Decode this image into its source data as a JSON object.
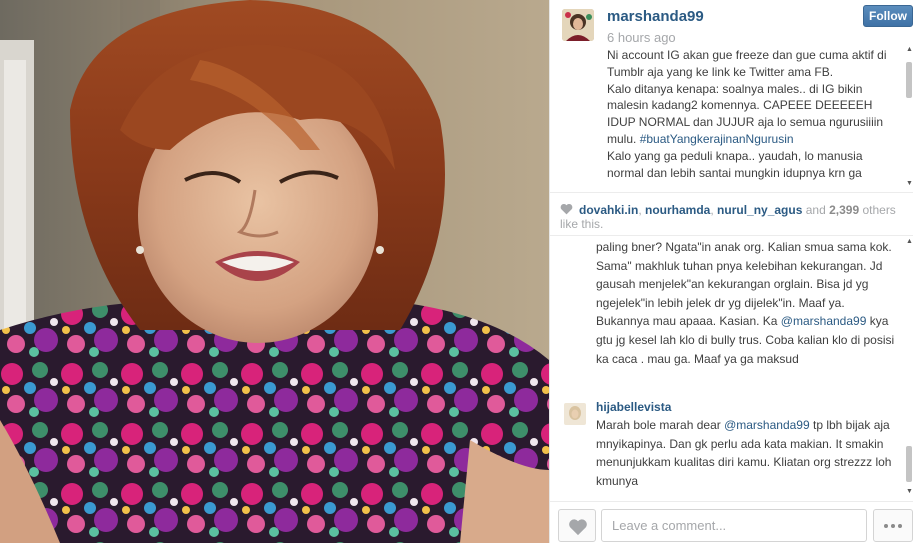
{
  "post": {
    "username": "marshanda99",
    "time_ago": "6 hours ago",
    "follow_label": "Follow",
    "caption": {
      "line1": "Ni account IG akan gue freeze dan gue cuma aktif di Tumblr aja yang ke link ke Twitter ama FB.",
      "line2": "Kalo ditanya kenapa: soalnya males.. di IG bikin malesin kadang2 komennya. CAPEEE DEEEEEH IDUP NORMAL dan JUJUR aja lo semua ngurusiiiin mulu. ",
      "hashtag": "#buatYangkerajinanNgurusin",
      "line3": "Kalo yang ga peduli knapa.. yaudah, lo manusia normal dan lebih santai mungkin idupnya krn ga"
    }
  },
  "likes": {
    "likers": [
      "dovahki.in",
      "nourhamda",
      "nurul_ny_agus"
    ],
    "separator": ", ",
    "and_text": " and ",
    "count": "2,399",
    "suffix": " others like this."
  },
  "comments": [
    {
      "part1": "paling bner? Ngata\"in anak org. Kalian smua sama kok. Sama\" makhluk tuhan pnya kelebihan kekurangan. Jd gausah menjelek\"an kekurangan orglain. Bisa jd yg ngejelek\"in lebih jelek dr yg dijelek\"in. Maaf ya. Bukannya mau apaaa. Kasian. Ka ",
      "mention": "@marshanda99",
      "part2": " kya gtu jg kesel lah klo di bully trus. Coba kalian klo di posisi ka caca . mau ga. Maaf ya ga maksud"
    },
    {
      "user": "hijabellevista",
      "part1": "Marah bole marah dear ",
      "mention": "@marshanda99",
      "part2": " tp lbh bijak aja mnyikapinya. Dan gk perlu ada kata makian. It smakin menunjukkam kualitas diri kamu. Kliatan org strezzz loh kmunya"
    }
  ],
  "footer": {
    "comment_placeholder": "Leave a comment..."
  },
  "icons": {
    "like": "heart-icon",
    "more": "more-dots-icon",
    "scroll_up": "arrow-up-icon",
    "scroll_down": "arrow-down-icon"
  },
  "colors": {
    "link": "#2b5a83",
    "follow_button": "#4a7db1",
    "muted": "#a5a7aa"
  }
}
